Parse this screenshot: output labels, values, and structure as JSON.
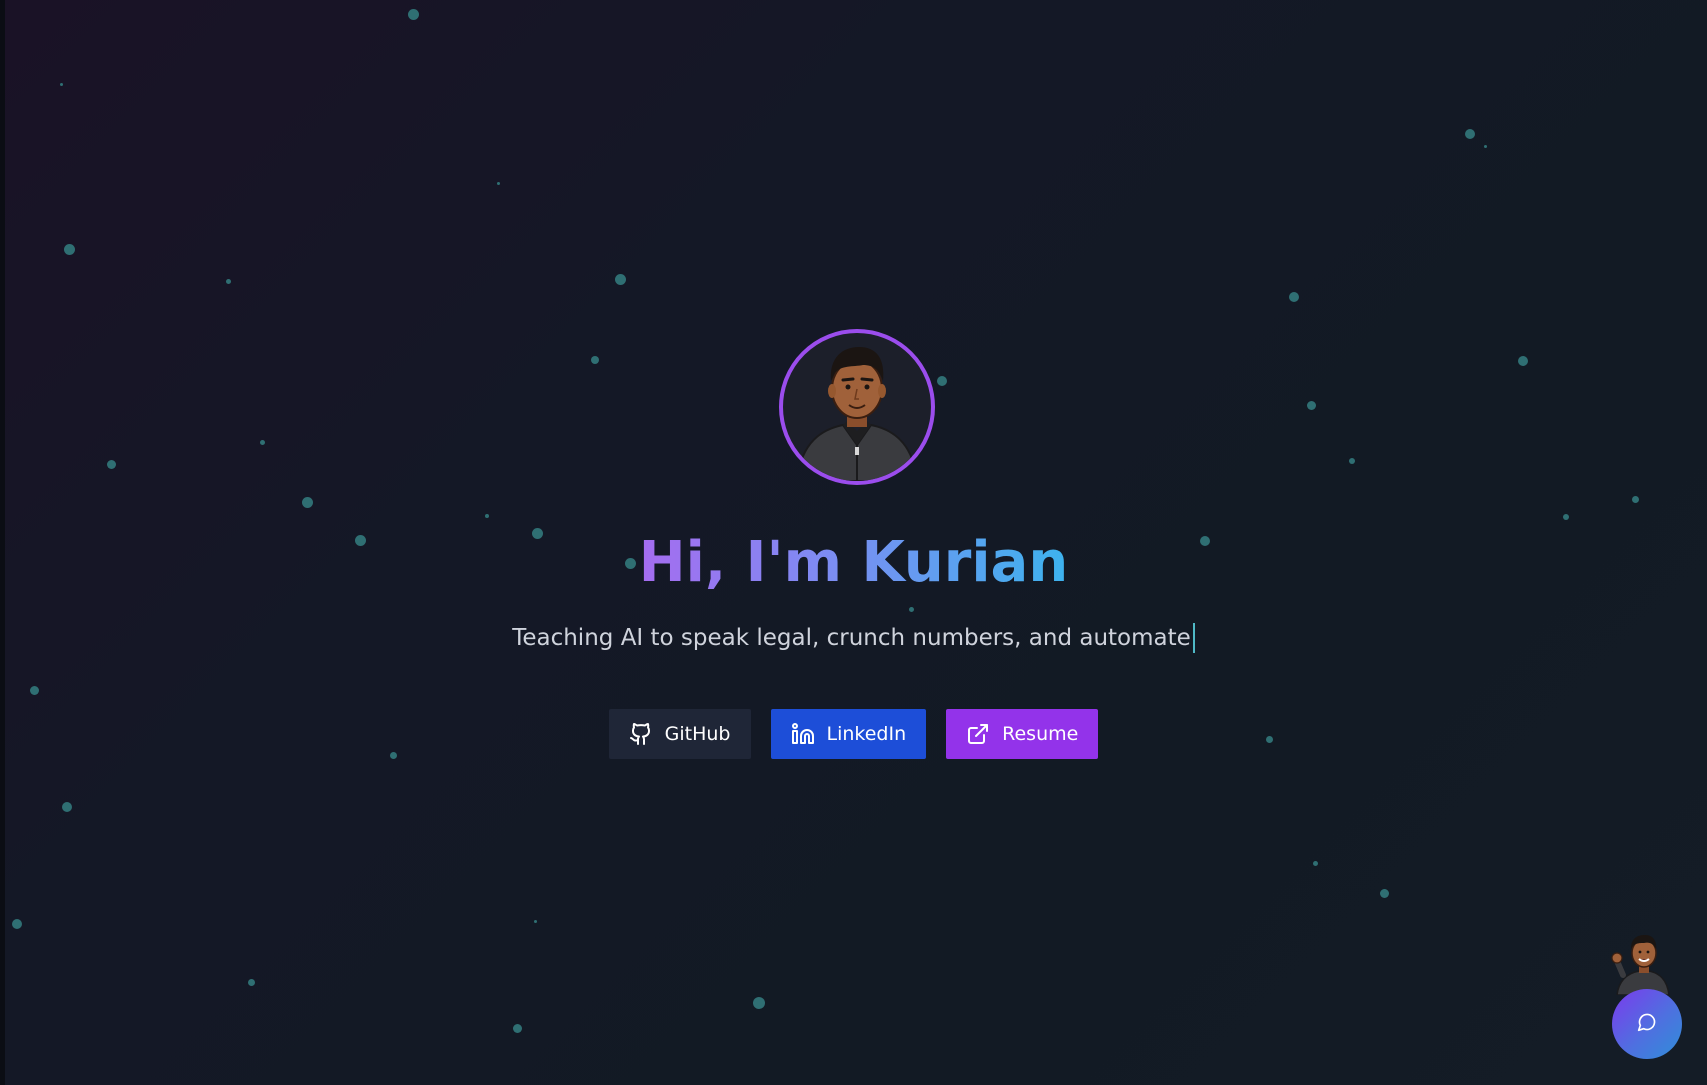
{
  "hero": {
    "title": "Hi, I'm Kurian",
    "subtitle": "Teaching AI to speak legal, crunch numbers, and automate"
  },
  "links": [
    {
      "label": "GitHub",
      "icon": "github-icon"
    },
    {
      "label": "LinkedIn",
      "icon": "linkedin-icon"
    },
    {
      "label": "Resume",
      "icon": "external-link-icon"
    }
  ],
  "chat": {
    "icon": "chat-bubble-icon"
  },
  "colors": {
    "avatar_ring": "#9b4ded",
    "title_gradient_start": "#a56cf0",
    "title_gradient_end": "#3db3ee",
    "github_button": "#1f2637",
    "linkedin_button": "#1d4ed8",
    "resume_button": "#9333ea",
    "star": "#2f6f73"
  }
}
